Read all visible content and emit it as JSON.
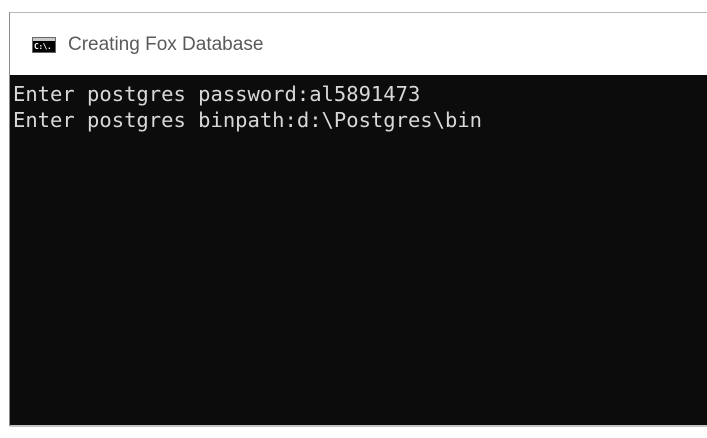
{
  "window": {
    "title": "Creating Fox Database",
    "icon": "console-app-icon",
    "icon_label": "C:\\."
  },
  "console": {
    "lines": [
      "Enter postgres password:al5891473",
      "Enter postgres binpath:d:\\Postgres\\bin"
    ],
    "background_color": "#0c0c0c",
    "text_color": "#d8d8d8"
  }
}
